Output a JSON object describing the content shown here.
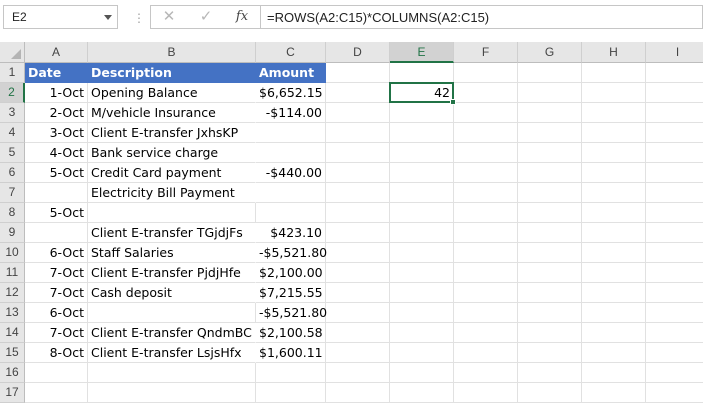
{
  "formula_bar": {
    "name_box": "E2",
    "cancel_icon": "✕",
    "enter_icon": "✓",
    "fx_label": "fx",
    "formula": "=ROWS(A2:C15)*COLUMNS(A2:C15)"
  },
  "columns": [
    "A",
    "B",
    "C",
    "D",
    "E",
    "F",
    "G",
    "H",
    "I"
  ],
  "rows": [
    "1",
    "2",
    "3",
    "4",
    "5",
    "6",
    "7",
    "8",
    "9",
    "10",
    "11",
    "12",
    "13",
    "14",
    "15",
    "16",
    "17"
  ],
  "selected_cell": {
    "col": "E",
    "row": "2"
  },
  "header_color": "#4472c4",
  "selection_color": "#217346",
  "table": {
    "headers": [
      "Date",
      "Description",
      "Amount"
    ],
    "rows": [
      [
        "1-Oct",
        "Opening Balance",
        "$6,652.15"
      ],
      [
        "2-Oct",
        "M/vehicle Insurance",
        "-$114.00"
      ],
      [
        "3-Oct",
        "Client E-transfer JxhsKP",
        ""
      ],
      [
        "4-Oct",
        "Bank service charge",
        ""
      ],
      [
        "5-Oct",
        "Credit Card payment",
        "-$440.00"
      ],
      [
        "",
        "Electricity Bill Payment",
        ""
      ],
      [
        "5-Oct",
        "",
        ""
      ],
      [
        "",
        "Client E-transfer TGjdjFs",
        "$423.10"
      ],
      [
        "6-Oct",
        "Staff Salaries",
        "-$5,521.80"
      ],
      [
        "7-Oct",
        "Client E-transfer PjdjHfe",
        "$2,100.00"
      ],
      [
        "7-Oct",
        "Cash deposit",
        "$7,215.55"
      ],
      [
        "6-Oct",
        "",
        "-$5,521.80"
      ],
      [
        "7-Oct",
        "Client E-transfer QndmBC",
        "$2,100.58"
      ],
      [
        "8-Oct",
        "Client E-transfer LsjsHfx",
        "$1,600.11"
      ]
    ]
  },
  "result_cell": {
    "ref": "E2",
    "value": "42"
  }
}
